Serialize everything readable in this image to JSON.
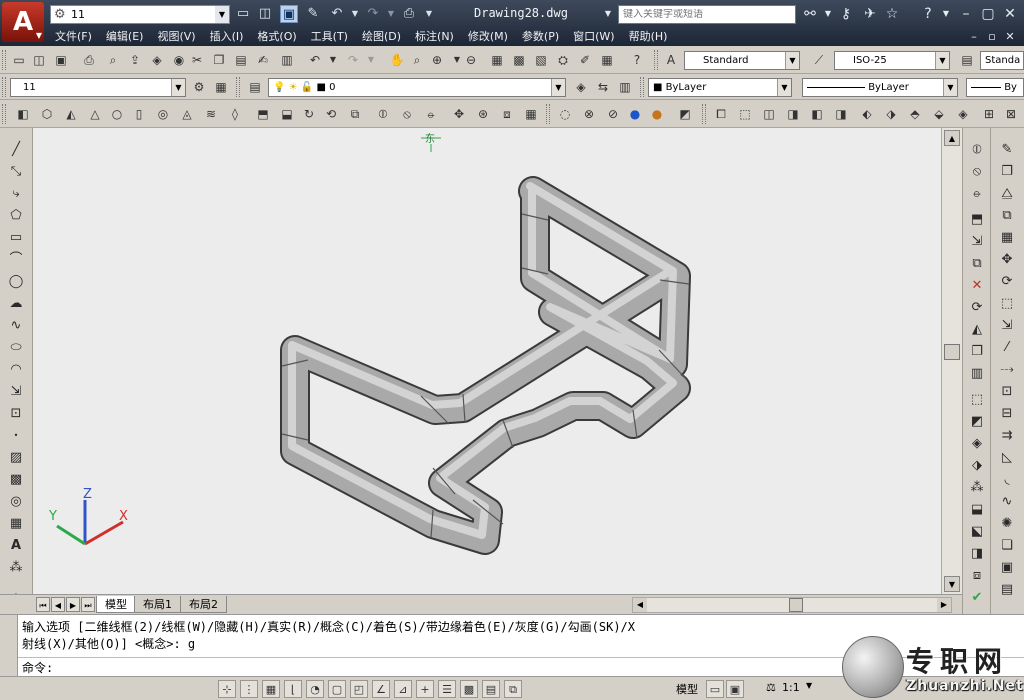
{
  "app": {
    "logo_letter": "A",
    "workspace": "11",
    "doc_title": "Drawing28.dwg",
    "search_placeholder": "键入关键字或短语"
  },
  "menus": [
    "文件(F)",
    "编辑(E)",
    "视图(V)",
    "插入(I)",
    "格式(O)",
    "工具(T)",
    "绘图(D)",
    "标注(N)",
    "修改(M)",
    "参数(P)",
    "窗口(W)",
    "帮助(H)"
  ],
  "toolbar": {
    "text_style": "Standard",
    "dim_style": "ISO-25",
    "table_style": "Standa",
    "workspace_combo": "11",
    "layer": "0",
    "color": "ByLayer",
    "linetype": "ByLayer",
    "lineweight": "By"
  },
  "tabs": {
    "model": "模型",
    "layout1": "布局1",
    "layout2": "布局2"
  },
  "command": {
    "line1": "输入选项 [二维线框(2)/线框(W)/隐藏(H)/真实(R)/概念(C)/着色(S)/带边缘着色(E)/灰度(G)/勾画(SK)/X",
    "line2": "射线(X)/其他(O)] <概念>: g",
    "prompt": "命令:"
  },
  "status": {
    "model_label": "模型",
    "scale": "1:1"
  },
  "ucs": {
    "x_label": "X",
    "y_label": "Y",
    "z_label": "Z"
  },
  "viewcube_label": "东",
  "watermark": {
    "title": "专职网",
    "subtitle": "Zhuanzhi.Net"
  },
  "colors": {
    "x_axis": "#d0302a",
    "y_axis": "#2ba84a",
    "z_axis": "#2f55c8",
    "pipe": "#9a9a9a",
    "canvas_bg": "#ececec"
  }
}
